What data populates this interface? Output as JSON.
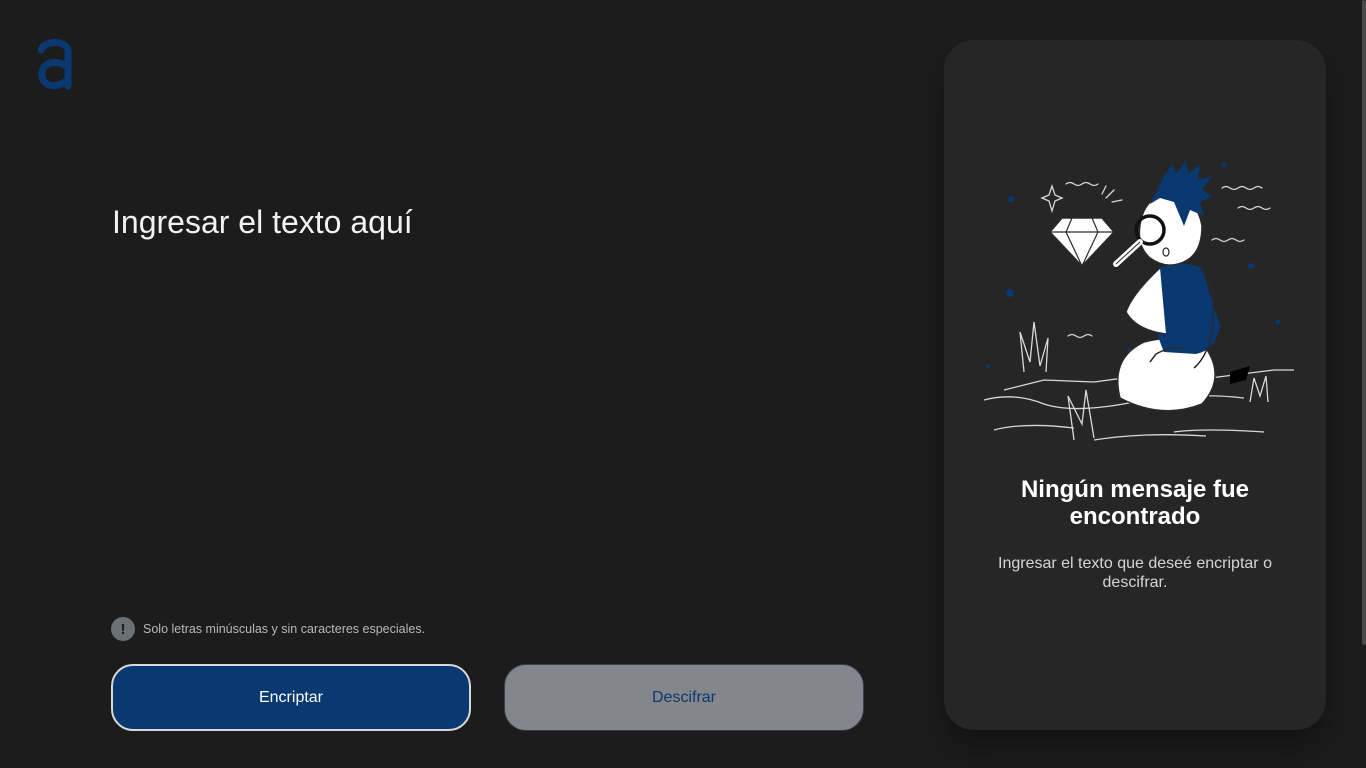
{
  "brand": {
    "logo_letter": "a",
    "accent_color": "#0a3871"
  },
  "input": {
    "placeholder": "Ingresar el texto aquí",
    "value": ""
  },
  "hint": {
    "icon": "exclamation-icon",
    "text": "Solo letras minúsculas y sin caracteres especiales."
  },
  "actions": {
    "encrypt_label": "Encriptar",
    "decrypt_label": "Descifrar"
  },
  "result_panel": {
    "illustration": "person-with-magnifying-glass-and-diamond",
    "title_line1": "Ningún mensaje fue",
    "title_line2": "encontrado",
    "subtitle": "Ingresar el texto que deseé encriptar o descifrar."
  }
}
